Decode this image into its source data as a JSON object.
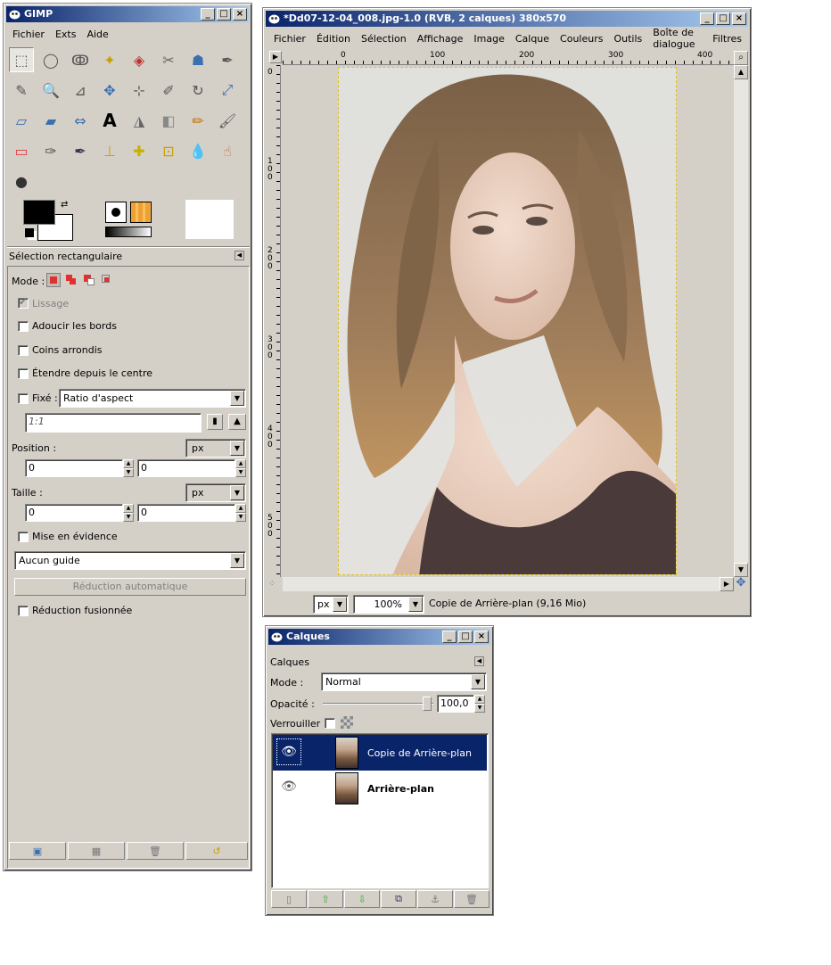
{
  "toolbox": {
    "title": "GIMP",
    "menu": [
      "Fichier",
      "Exts",
      "Aide"
    ],
    "tools": [
      "rect-select-icon",
      "ellipse-select-icon",
      "free-select-icon",
      "fuzzy-select-icon",
      "color-select-icon",
      "scissors-icon",
      "foreground-select-icon",
      "paths-icon",
      "color-picker-icon",
      "zoom-icon",
      "measure-icon",
      "move-icon",
      "align-icon",
      "crop-icon",
      "rotate-icon",
      "scale-icon",
      "shear-icon",
      "perspective-icon",
      "flip-icon",
      "text-icon",
      "bucket-fill-icon",
      "gradient-icon",
      "pencil-icon",
      "paintbrush-icon",
      "eraser-icon",
      "airbrush-icon",
      "ink-icon",
      "clone-icon",
      "heal-icon",
      "perspective-clone-icon",
      "blur-icon",
      "smudge-icon",
      "dodge-burn-icon"
    ],
    "tool_glyphs": [
      "⬚",
      "◯",
      "ↂ",
      "✦",
      "◈",
      "✂",
      "☗",
      "✒",
      "✎",
      "🔍",
      "⊿",
      "✥",
      "⊹",
      "✐",
      "↻",
      "⤢",
      "▱",
      "▰",
      "⇔",
      "A",
      "◮",
      "◧",
      "✏",
      "🖌",
      "▭",
      "✑",
      "✒",
      "⊥",
      "✚",
      "⊡",
      "💧",
      "☝",
      "●"
    ],
    "tool_colors": [
      "#555",
      "#555",
      "#555",
      "#c8a000",
      "#c03030",
      "#666",
      "#3a6fb0",
      "#555",
      "#555",
      "#3a6fb0",
      "#555",
      "#3a6fb0",
      "#555",
      "#555",
      "#555",
      "#3a6fb0",
      "#3a6fb0",
      "#3a6fb0",
      "#3a6fb0",
      "#000",
      "#666",
      "#888",
      "#c87000",
      "#555",
      "#e04040",
      "#555",
      "#335",
      "#c8a000",
      "#c8b000",
      "#c8a000",
      "#5090d0",
      "#c87040",
      "#333"
    ],
    "fg_color": "#000000",
    "bg_color": "#ffffff",
    "options": {
      "header": "Sélection rectangulaire",
      "mode_label": "Mode :",
      "lissage": "Lissage",
      "adoucir": "Adoucir les bords",
      "coins": "Coins arrondis",
      "etendre": "Étendre depuis le centre",
      "fixe": "Fixé :",
      "fixe_combo": "Ratio d'aspect",
      "ratio_value": "1:1",
      "position_label": "Position :",
      "position_unit": "px",
      "position_x": "0",
      "position_y": "0",
      "taille_label": "Taille :",
      "taille_unit": "px",
      "taille_w": "0",
      "taille_h": "0",
      "mise_en_evidence": "Mise en évidence",
      "guide_combo": "Aucun guide",
      "reduction_auto": "Réduction automatique",
      "reduction_fusionnee": "Réduction fusionnée"
    }
  },
  "image_window": {
    "title": "*Dd07-12-04_008.jpg-1.0 (RVB, 2 calques) 380x570",
    "menu": [
      "Fichier",
      "Édition",
      "Sélection",
      "Affichage",
      "Image",
      "Calque",
      "Couleurs",
      "Outils",
      "Boîte de dialogue",
      "Filtres"
    ],
    "ruler_h": [
      "0",
      "100",
      "200",
      "300",
      "400"
    ],
    "ruler_v": [
      "0",
      "100",
      "200",
      "300",
      "400",
      "500"
    ],
    "status_unit": "px",
    "zoom": "100%",
    "status_text": "Copie de Arrière-plan (9,16 Mio)"
  },
  "layers": {
    "title": "Calques",
    "header": "Calques",
    "mode_label": "Mode :",
    "mode_value": "Normal",
    "opacity_label": "Opacité :",
    "opacity_value": "100,0",
    "lock_label": "Verrouiller :",
    "items": [
      {
        "name": "Copie de Arrière-plan",
        "selected": true
      },
      {
        "name": "Arrière-plan",
        "selected": false
      }
    ]
  }
}
